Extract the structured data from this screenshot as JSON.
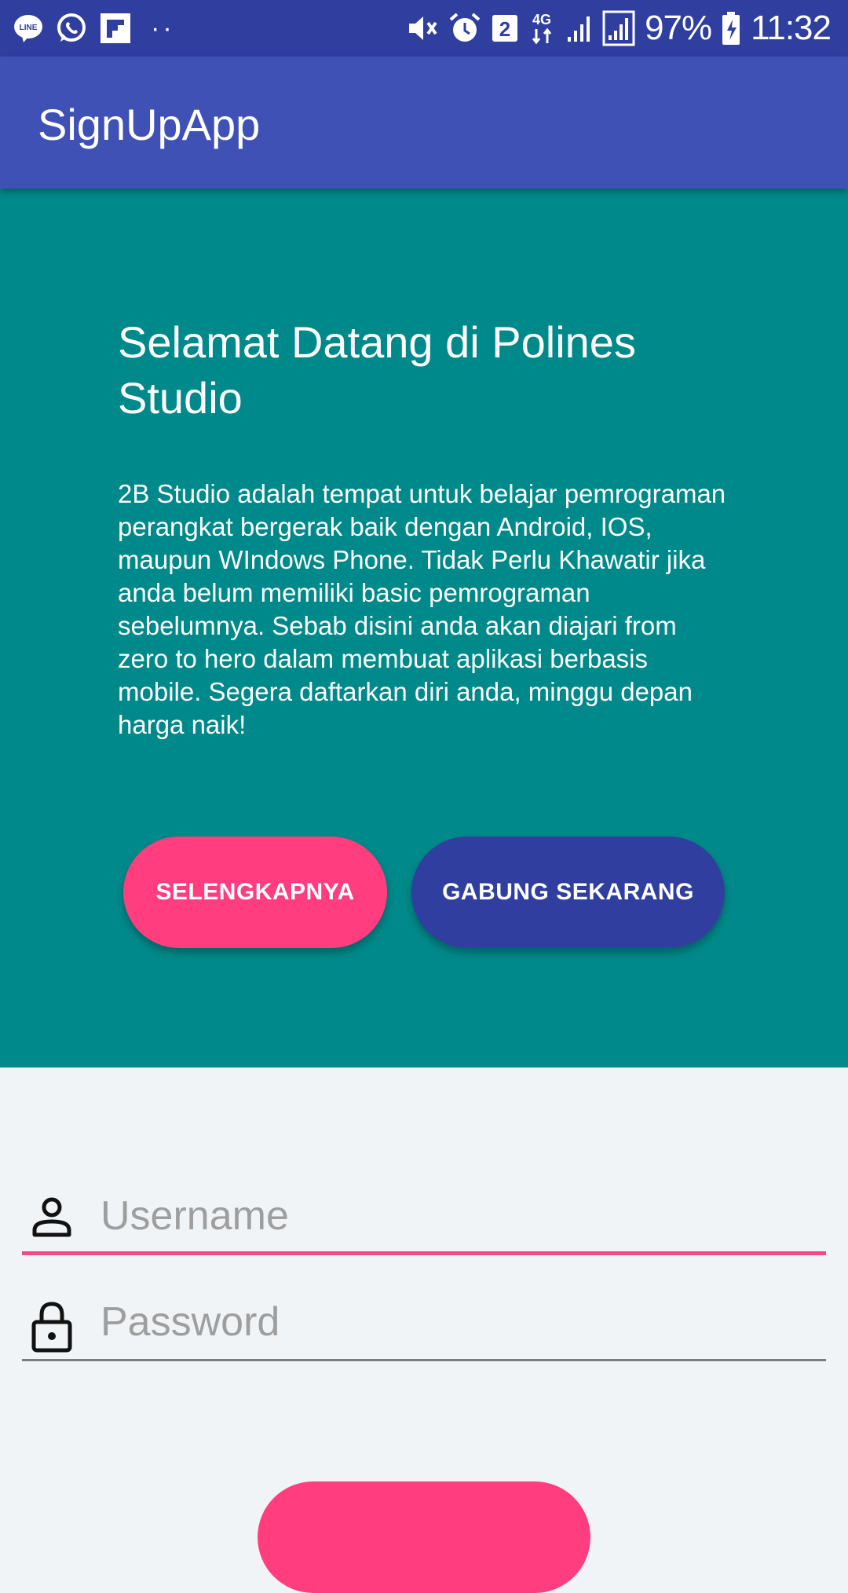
{
  "status_bar": {
    "battery": "97%",
    "time": "11:32",
    "sim_badge": "2",
    "network": "4G",
    "icons": [
      "line-icon",
      "whatsapp-icon",
      "flipboard-icon",
      "more-dots",
      "mute-icon",
      "alarm-icon",
      "sim-icon",
      "network-4g-icon",
      "signal-icon",
      "signal-icon",
      "battery-icon"
    ]
  },
  "app_bar": {
    "title": "SignUpApp"
  },
  "hero": {
    "heading": "Selamat Datang di Polines Studio",
    "body": "2B Studio adalah tempat untuk belajar pemrograman perangkat bergerak baik dengan Android, IOS, maupun WIndows Phone. Tidak Perlu Khawatir jika anda belum memiliki basic pemrograman sebelumnya. Sebab disini anda akan diajari from zero to hero dalam membuat aplikasi berbasis mobile. Segera daftarkan diri anda, minggu depan harga naik!",
    "more_button": "SELENGKAPNYA",
    "join_button": "GABUNG SEKARANG"
  },
  "form": {
    "username_placeholder": "Username",
    "password_placeholder": "Password"
  },
  "colors": {
    "status_bar": "#303f9f",
    "app_bar": "#3f51b5",
    "hero_bg": "#00898a",
    "accent_pink": "#ff3d7f",
    "indigo_button": "#303f9f",
    "page_bg": "#f1f4f7"
  }
}
